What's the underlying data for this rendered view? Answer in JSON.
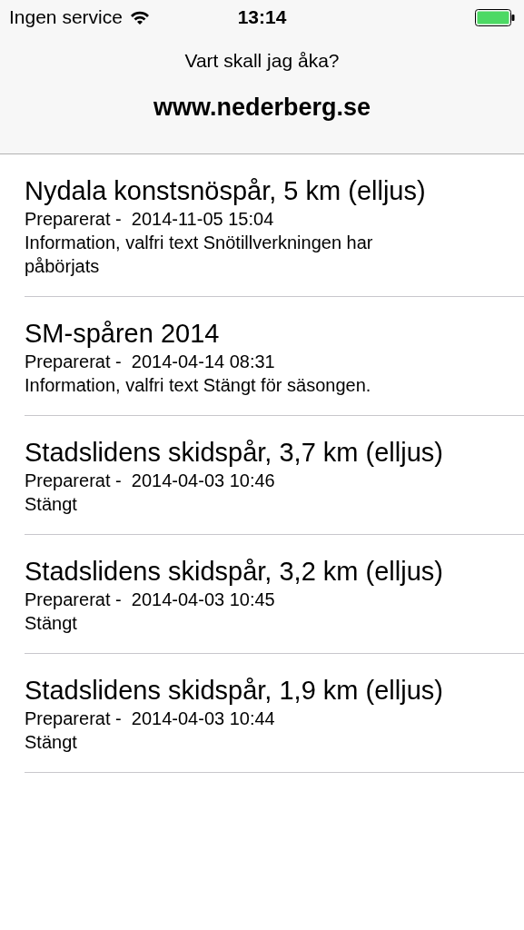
{
  "status_bar": {
    "carrier": "Ingen service",
    "time": "13:14"
  },
  "nav": {
    "prompt": "Vart skall jag åka?",
    "title": "www.nederberg.se"
  },
  "trails": [
    {
      "name": "Nydala konstsnöspår, 5 km (elljus)",
      "prepared": "Preparerat -  2014-11-05 15:04",
      "info": "Information, valfri text Snötillverkningen har påbörjats"
    },
    {
      "name": "SM-spåren 2014",
      "prepared": "Preparerat -  2014-04-14 08:31",
      "info": "Information, valfri text Stängt för säsongen."
    },
    {
      "name": "Stadslidens skidspår, 3,7 km (elljus)",
      "prepared": "Preparerat -  2014-04-03 10:46",
      "info": "Stängt"
    },
    {
      "name": "Stadslidens skidspår, 3,2 km (elljus)",
      "prepared": "Preparerat -  2014-04-03 10:45",
      "info": "Stängt"
    },
    {
      "name": "Stadslidens skidspår, 1,9 km (elljus)",
      "prepared": "Preparerat -  2014-04-03 10:44",
      "info": "Stängt"
    }
  ]
}
